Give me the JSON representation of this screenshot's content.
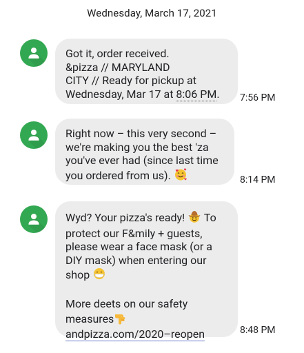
{
  "date_header": "Wednesday, March 17, 2021",
  "colors": {
    "avatar": "#33a852",
    "bubble": "#ececec"
  },
  "messages": [
    {
      "avatar_icon": "person-icon",
      "lines": [
        "Got it, order received.",
        "&pizza // MARYLAND",
        "CITY // Ready for pickup at"
      ],
      "last_line_prefix": "Wednesday, Mar 17 at ",
      "last_line_time": "8:06 PM",
      "last_line_suffix": ".",
      "timestamp": "7:56 PM"
    },
    {
      "avatar_icon": "person-icon",
      "lines": [
        "Right now – this very second –",
        "we're making you the best 'za",
        "you've ever had (since last time"
      ],
      "last_line": "you ordered from us).",
      "emoji": "smiling-face-with-hearts",
      "timestamp": "8:14 PM"
    },
    {
      "avatar_icon": "person-icon",
      "line1_prefix": "Wyd? Your pizza's ready!",
      "line1_emoji": "cowboy-hat-face",
      "line1_suffix": "To",
      "lines": [
        "protect our F&mily + guests,",
        "please wear a face mask (or a",
        "DIY mask) when entering our"
      ],
      "shop_line": "shop",
      "shop_emoji": "face-with-medical-mask",
      "more_line1": "More deets on our safety",
      "more_line2": "measures",
      "pointing_emoji": "backhand-index-pointing-down",
      "link": "andpizza.com/2020–reopen",
      "timestamp": "8:48 PM"
    }
  ]
}
